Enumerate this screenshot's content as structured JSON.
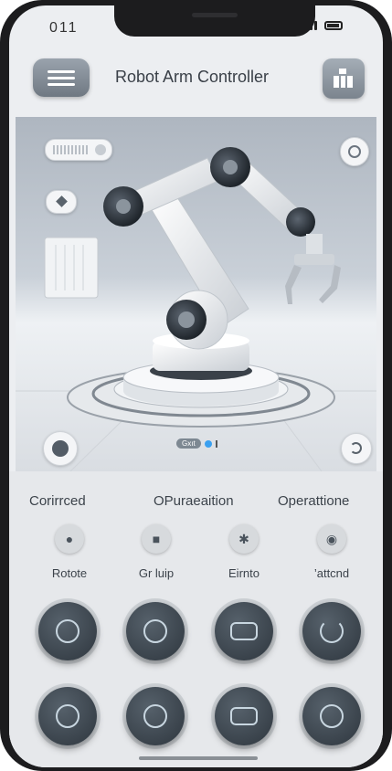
{
  "status": {
    "time": "011"
  },
  "header": {
    "title": "Robot Arm Controller"
  },
  "scene": {
    "status_text": "Gxıt"
  },
  "panel": {
    "sections": [
      "Corirrced",
      "OPuraeaition",
      "Operattione"
    ],
    "actions": [
      {
        "label": "Rotote",
        "icon": "joystick-icon"
      },
      {
        "label": "Gr luip",
        "icon": "gripper-icon"
      },
      {
        "label": "Eirnto",
        "icon": "joint-icon"
      },
      {
        "label": "’attcnd",
        "icon": "camera-icon"
      }
    ]
  },
  "colors": {
    "accent": "#3aa0f0",
    "button_dark": "#3a434c"
  }
}
